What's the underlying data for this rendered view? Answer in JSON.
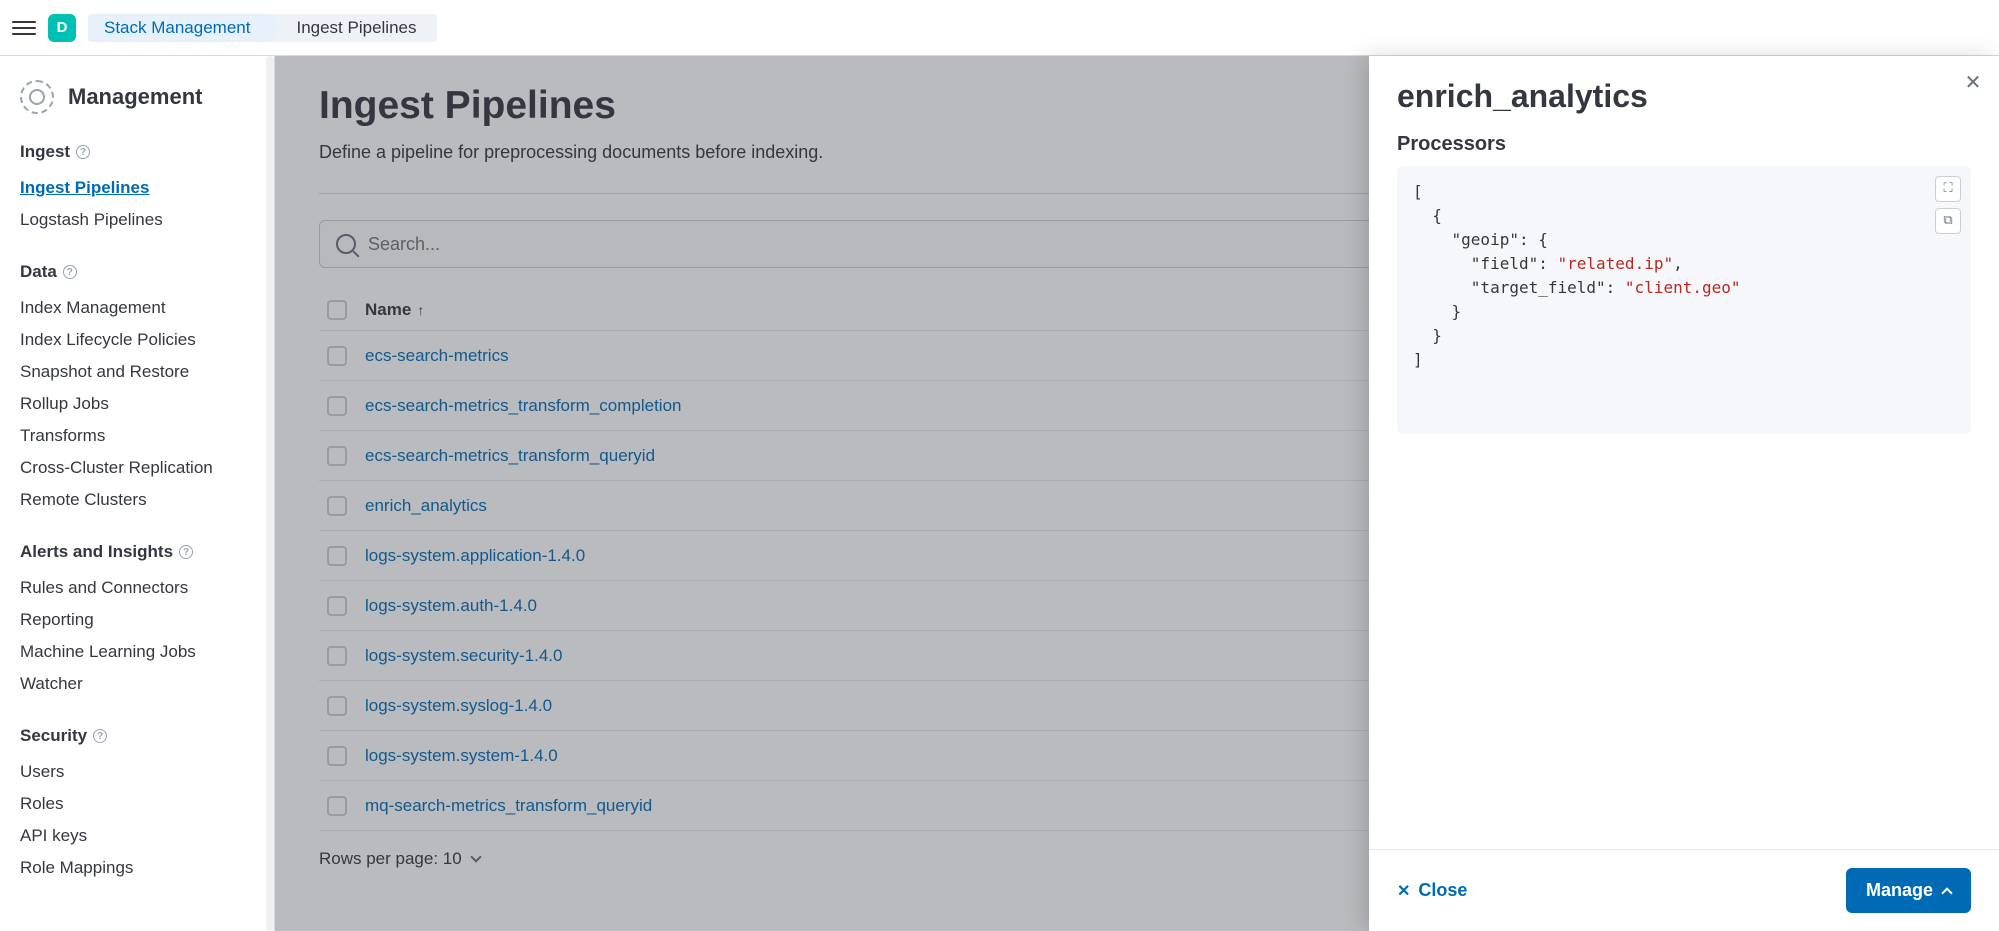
{
  "topbar": {
    "logo_letter": "D",
    "breadcrumbs": [
      "Stack Management",
      "Ingest Pipelines"
    ]
  },
  "sidebar": {
    "title": "Management",
    "groups": [
      {
        "name": "Ingest",
        "has_info": true,
        "items": [
          {
            "label": "Ingest Pipelines",
            "active": true
          },
          {
            "label": "Logstash Pipelines",
            "active": false
          }
        ]
      },
      {
        "name": "Data",
        "has_info": true,
        "items": [
          {
            "label": "Index Management"
          },
          {
            "label": "Index Lifecycle Policies"
          },
          {
            "label": "Snapshot and Restore"
          },
          {
            "label": "Rollup Jobs"
          },
          {
            "label": "Transforms"
          },
          {
            "label": "Cross-Cluster Replication"
          },
          {
            "label": "Remote Clusters"
          }
        ]
      },
      {
        "name": "Alerts and Insights",
        "has_info": true,
        "items": [
          {
            "label": "Rules and Connectors"
          },
          {
            "label": "Reporting"
          },
          {
            "label": "Machine Learning Jobs"
          },
          {
            "label": "Watcher"
          }
        ]
      },
      {
        "name": "Security",
        "has_info": true,
        "items": [
          {
            "label": "Users"
          },
          {
            "label": "Roles"
          },
          {
            "label": "API keys"
          },
          {
            "label": "Role Mappings"
          }
        ]
      }
    ]
  },
  "main": {
    "title": "Ingest Pipelines",
    "subtitle": "Define a pipeline for preprocessing documents before indexing.",
    "search_placeholder": "Search...",
    "column_name": "Name",
    "rows": [
      "ecs-search-metrics",
      "ecs-search-metrics_transform_completion",
      "ecs-search-metrics_transform_queryid",
      "enrich_analytics",
      "logs-system.application-1.4.0",
      "logs-system.auth-1.4.0",
      "logs-system.security-1.4.0",
      "logs-system.syslog-1.4.0",
      "logs-system.system-1.4.0",
      "mq-search-metrics_transform_queryid"
    ],
    "rows_per_page_label": "Rows per page: 10"
  },
  "flyout": {
    "title": "enrich_analytics",
    "section": "Processors",
    "processors_json": [
      {
        "geoip": {
          "field": "related.ip",
          "target_field": "client.geo"
        }
      }
    ],
    "close_label": "Close",
    "manage_label": "Manage"
  }
}
